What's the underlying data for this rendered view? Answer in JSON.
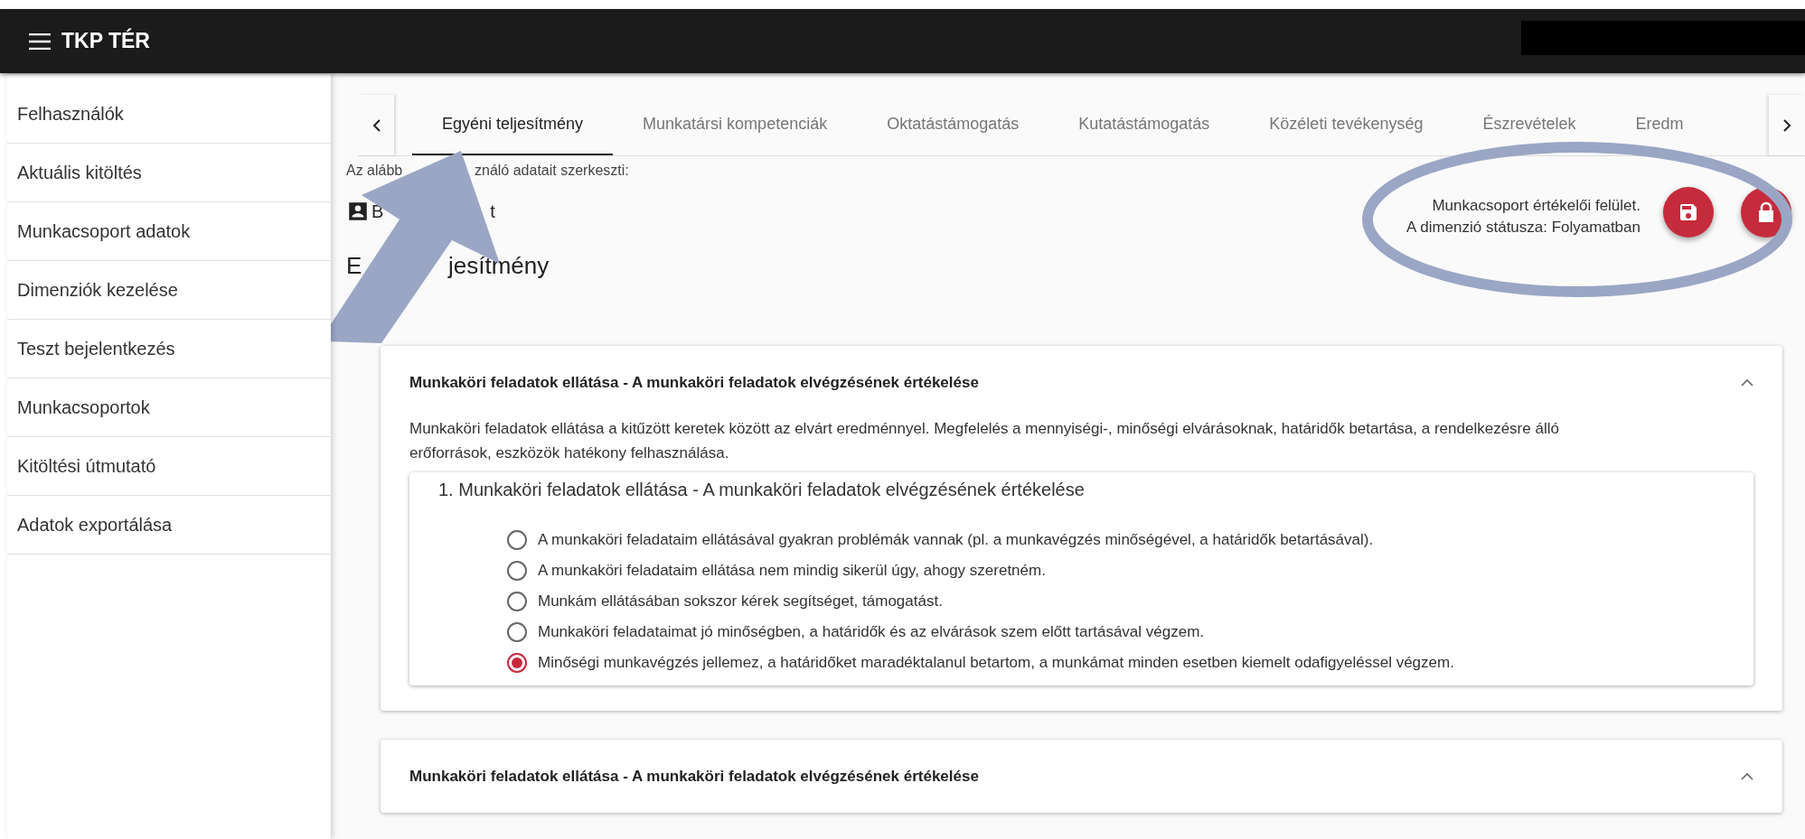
{
  "app_bar": {
    "title": "TKP TÉR"
  },
  "sidebar": {
    "items": [
      {
        "label": "Felhasználók"
      },
      {
        "label": "Aktuális kitöltés"
      },
      {
        "label": "Munkacsoport adatok"
      },
      {
        "label": "Dimenziók kezelése"
      },
      {
        "label": "Teszt bejelentkezés"
      },
      {
        "label": "Munkacsoportok"
      },
      {
        "label": "Kitöltési útmutató"
      },
      {
        "label": "Adatok exportálása"
      }
    ]
  },
  "tabs": [
    {
      "label": "Egyéni teljesítmény",
      "selected": true
    },
    {
      "label": "Munkatársi kompetenciák",
      "selected": false
    },
    {
      "label": "Oktatástámogatás",
      "selected": false
    },
    {
      "label": "Kutatástámogatás",
      "selected": false
    },
    {
      "label": "Közéleti tevékenység",
      "selected": false
    },
    {
      "label": "Észrevételek",
      "selected": false
    },
    {
      "label": "Eredm",
      "selected": false
    }
  ],
  "editing_note_parts": [
    "Az alább",
    "ználó adatait szerkeszti:"
  ],
  "user_name_parts": [
    "B",
    "t"
  ],
  "status": {
    "line_1": "Munkacsoport értékelői felület.",
    "line_2": "A dimenzió státusza: Folyamatban"
  },
  "page_heading_parts": [
    "E",
    "jesítmény"
  ],
  "cards": [
    {
      "title": "Munkaköri feladatok ellátása - A munkaköri feladatok elvégzésének értékelése",
      "expanded": true,
      "description": "Munkaköri feladatok ellátása a kitűzött keretek között az elvárt eredménnyel. Megfelelés a mennyiségi-, minőségi elvárásoknak, határidők betartása, a rendelkezésre álló erőforrások, eszközök hatékony felhasználása.",
      "question": {
        "title": "1. Munkaköri feladatok ellátása - A munkaköri feladatok elvégzésének értékelése",
        "options": [
          {
            "label": "A munkaköri feladataim ellátásával gyakran problémák vannak (pl. a munkavégzés minőségével, a határidők betartásával).",
            "selected": false
          },
          {
            "label": "A munkaköri feladataim ellátása nem mindig sikerül úgy, ahogy szeretném.",
            "selected": false
          },
          {
            "label": "Munkám ellátásában sokszor kérek segítséget, támogatást.",
            "selected": false
          },
          {
            "label": "Munkaköri feladataimat jó minőségben, a határidők és az elvárások szem előtt tartásával végzem.",
            "selected": false
          },
          {
            "label": "Minőségi munkavégzés jellemez, a határidőket maradéktalanul betartom, a munkámat minden esetben kiemelt odafigyeléssel végzem.",
            "selected": true
          }
        ]
      }
    },
    {
      "title": "Munkaköri feladatok ellátása - A munkaköri feladatok elvégzésének értékelése",
      "expanded": true
    }
  ]
}
